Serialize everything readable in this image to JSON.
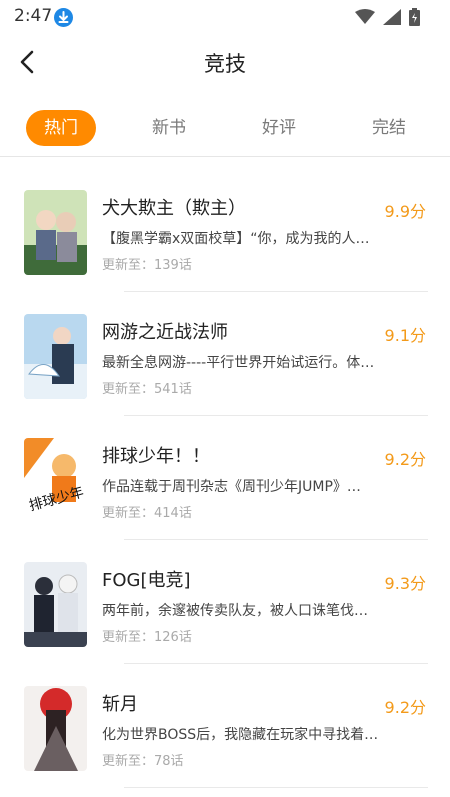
{
  "status": {
    "time": "2:47"
  },
  "header": {
    "title": "竞技"
  },
  "tabs": [
    {
      "label": "热门"
    },
    {
      "label": "新书"
    },
    {
      "label": "好评"
    },
    {
      "label": "完结"
    }
  ],
  "list": {
    "update_prefix": "更新至：",
    "items": [
      {
        "title": "犬大欺主（欺主）",
        "score": "9.9分",
        "desc": "【腹黑学霸x双面校草】“你，成为我的人…",
        "update": "139话"
      },
      {
        "title": "网游之近战法师",
        "score": "9.1分",
        "desc": " 最新全息网游----平行世界开始试运行。体…",
        "update": "541话"
      },
      {
        "title": "排球少年！！",
        "score": "9.2分",
        "desc": "作品连载于周刊杂志《周刊少年JUMP》…",
        "update": "414话"
      },
      {
        "title": "FOG[电竞]",
        "score": "9.3分",
        "desc": "两年前，余邃被传卖队友，被人口诛笔伐…",
        "update": "126话"
      },
      {
        "title": "斩月",
        "score": "9.2分",
        "desc": "化为世界BOSS后，我隐藏在玩家中寻找着…",
        "update": "78话"
      }
    ]
  },
  "colors": {
    "accent": "#ff8a00",
    "score": "#f39a1a"
  }
}
